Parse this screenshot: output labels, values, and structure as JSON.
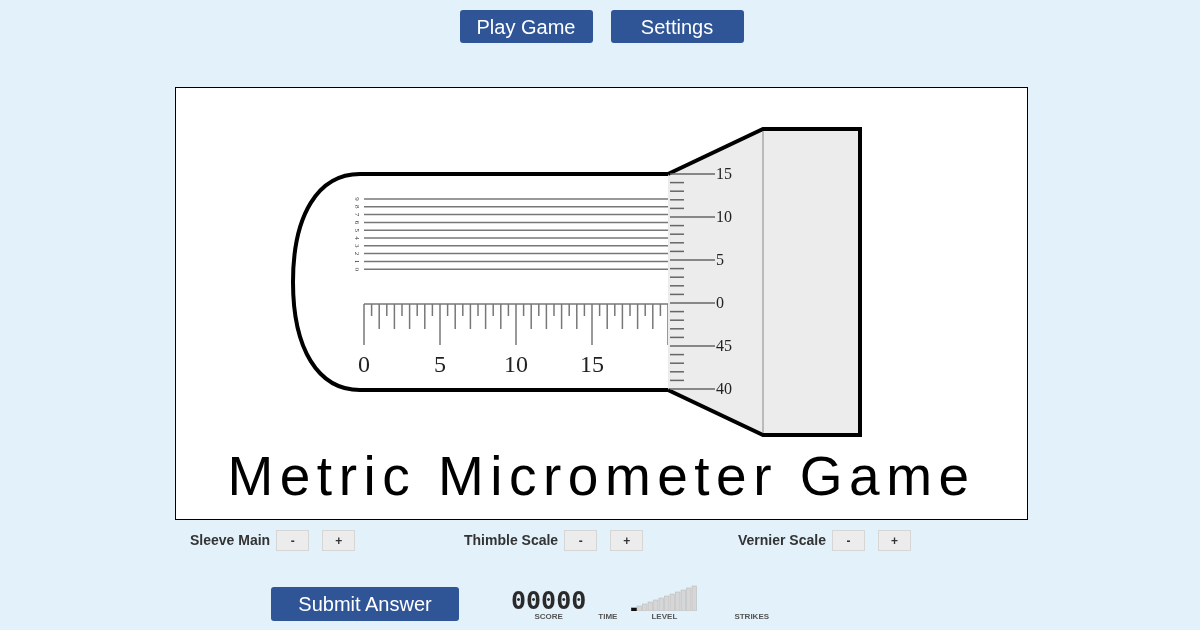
{
  "nav_buttons": [
    {
      "label": "Play Game"
    },
    {
      "label": "Settings"
    }
  ],
  "micrometer": {
    "vernier_scale": [
      "9",
      "8",
      "7",
      "6",
      "5",
      "4",
      "3",
      "2",
      "1",
      "0"
    ],
    "sleeve_scale": [
      "0",
      "5",
      "10",
      "15"
    ],
    "thimble_scale": [
      "15",
      "10",
      "5",
      "0",
      "45",
      "40"
    ]
  },
  "title": "Metric Micrometer Game",
  "adjusters": [
    {
      "label": "Sleeve Main",
      "buttons": [
        "-",
        "+"
      ]
    },
    {
      "label": "Thimble Scale",
      "buttons": [
        "-",
        "+"
      ]
    },
    {
      "label": "Vernier Scale",
      "buttons": [
        "-",
        "+"
      ]
    }
  ],
  "submit_button": "Submit Answer",
  "scoreboard": {
    "score": "00000",
    "score_label": "SCORE",
    "time_label": "TIME",
    "level_meter": {
      "level": 0.08
    },
    "level_label": "LEVEL",
    "strikes_label": "STRIKES"
  }
}
